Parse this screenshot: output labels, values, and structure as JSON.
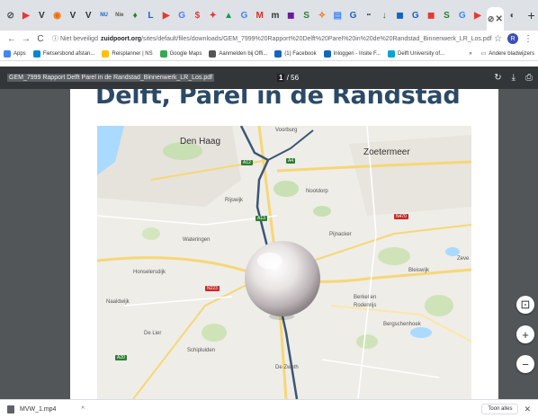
{
  "tabs": [
    {
      "icon": "chrome-icon",
      "glyph": "⊘",
      "color": "#555555"
    },
    {
      "icon": "youtube-icon",
      "glyph": "▶",
      "color": "#e53935"
    },
    {
      "icon": "v-icon",
      "glyph": "V",
      "color": "#333333"
    },
    {
      "icon": "orange-icon",
      "glyph": "◉",
      "color": "#ef6c00"
    },
    {
      "icon": "v-icon",
      "glyph": "V",
      "color": "#333333"
    },
    {
      "icon": "v-icon",
      "glyph": "V",
      "color": "#333333"
    },
    {
      "icon": "nu-icon",
      "glyph": "NU",
      "color": "#1565c0"
    },
    {
      "icon": "news-icon",
      "glyph": "Nie",
      "color": "#555555"
    },
    {
      "icon": "green-icon",
      "glyph": "♦",
      "color": "#2e7d32"
    },
    {
      "icon": "l-icon",
      "glyph": "L",
      "color": "#1565c0"
    },
    {
      "icon": "youtube-icon",
      "glyph": "▶",
      "color": "#e53935"
    },
    {
      "icon": "google-icon",
      "glyph": "G",
      "color": "#4285f4"
    },
    {
      "icon": "dollar-icon",
      "glyph": "$",
      "color": "#e53935"
    },
    {
      "icon": "red-icon",
      "glyph": "✦",
      "color": "#e53935"
    },
    {
      "icon": "drive-icon",
      "glyph": "▲",
      "color": "#0f9d58"
    },
    {
      "icon": "google-icon",
      "glyph": "G",
      "color": "#4285f4"
    },
    {
      "icon": "gmail-icon",
      "glyph": "M",
      "color": "#d93025"
    },
    {
      "icon": "m-icon",
      "glyph": "m",
      "color": "#333333"
    },
    {
      "icon": "purple-icon",
      "glyph": "◼",
      "color": "#6a1b9a"
    },
    {
      "icon": "s-icon",
      "glyph": "S",
      "color": "#2e7d32"
    },
    {
      "icon": "puzzle-icon",
      "glyph": "✧",
      "color": "#ef6c00"
    },
    {
      "icon": "docs-icon",
      "glyph": "▤",
      "color": "#4285f4"
    },
    {
      "icon": "g-icon",
      "glyph": "G",
      "color": "#1565c0"
    },
    {
      "icon": "dots-icon",
      "glyph": "••",
      "color": "#333333"
    },
    {
      "icon": "pin-icon",
      "glyph": "↓",
      "color": "#555555"
    },
    {
      "icon": "blue-icon",
      "glyph": "◼",
      "color": "#1565c0"
    },
    {
      "icon": "g-icon",
      "glyph": "G",
      "color": "#1565c0"
    },
    {
      "icon": "red-square-icon",
      "glyph": "◼",
      "color": "#e53935"
    },
    {
      "icon": "s-icon",
      "glyph": "S",
      "color": "#2e7d32"
    },
    {
      "icon": "google-icon",
      "glyph": "G",
      "color": "#4285f4"
    },
    {
      "icon": "play-icon",
      "glyph": "▶",
      "color": "#e53935"
    }
  ],
  "active_tab": {
    "glyph": "⊘",
    "close": "✕"
  },
  "pinned_tab": {
    "glyph": "◐"
  },
  "new_tab": "+",
  "nav": {
    "back": "←",
    "forward": "→",
    "reload": "C"
  },
  "address": {
    "security": "ⓘ Niet beveiligd",
    "host": "zuidpoort.org",
    "path": "/sites/default/files/downloads/GEM_7999%20Rapport%20Delft%20Parel%20in%20de%20Randstad_Binnenwerk_LR_Los.pdf"
  },
  "profile_initial": "R",
  "bookmarks": [
    {
      "label": "Apps",
      "color": "#4285f4"
    },
    {
      "label": "Fietsersbond afstan...",
      "color": "#0288d1"
    },
    {
      "label": "Reisplanner | NS",
      "color": "#ffc107"
    },
    {
      "label": "Google Maps",
      "color": "#34a853"
    },
    {
      "label": "Aanmelden bij Offi...",
      "color": "#555555"
    },
    {
      "label": "(1) Facebook",
      "color": "#1565c0"
    },
    {
      "label": "Inloggen - Insite F...",
      "color": "#1565c0"
    },
    {
      "label": "Delft University of...",
      "color": "#00a6d6"
    }
  ],
  "bookmarks_more": "»",
  "other_bookmarks": "Andere bladwijzers",
  "pdf": {
    "filename": "GEM_7999 Rapport Delft Parel in de Randstad_Binnenwerk_LR_Los.pdf",
    "page_current": "1",
    "page_total": "/ 56",
    "heading": "Delft, Parel in de Randstad"
  },
  "map_places": {
    "den_haag": "Den Haag",
    "zoetermeer": "Zoetermeer",
    "voorburg": "Voorburg",
    "rijswijk": "Rijswijk",
    "nootdorp": "Nootdorp",
    "pijnacker": "Pijnacker",
    "wateringen": "Wateringen",
    "honselersdijk": "Honselersdijk",
    "naaldwijk": "Naaldwijk",
    "de_lier": "De Lier",
    "schipluiden": "Schipluiden",
    "berkel": "Berkel en",
    "rodenrijs": "Rodenrijs",
    "bergschenhoek": "Bergschenhoek",
    "bleiswijk": "Bleiswijk",
    "zevenhuizen": "Zeve",
    "de_zweth": "De Zweth"
  },
  "road_badges": [
    "A12",
    "A4",
    "A13",
    "N223",
    "A20",
    "N470"
  ],
  "zoom": {
    "fit": "⊡",
    "in": "+",
    "out": "−"
  },
  "downloads": {
    "file": "MVW_1.mp4",
    "caret": "^",
    "show_all": "Toon alles",
    "close": "✕"
  },
  "colors": {
    "pdf_toolbar": "#323639",
    "pdf_bg": "#525659",
    "heading": "#2b4a66",
    "route": "#3b5677"
  }
}
